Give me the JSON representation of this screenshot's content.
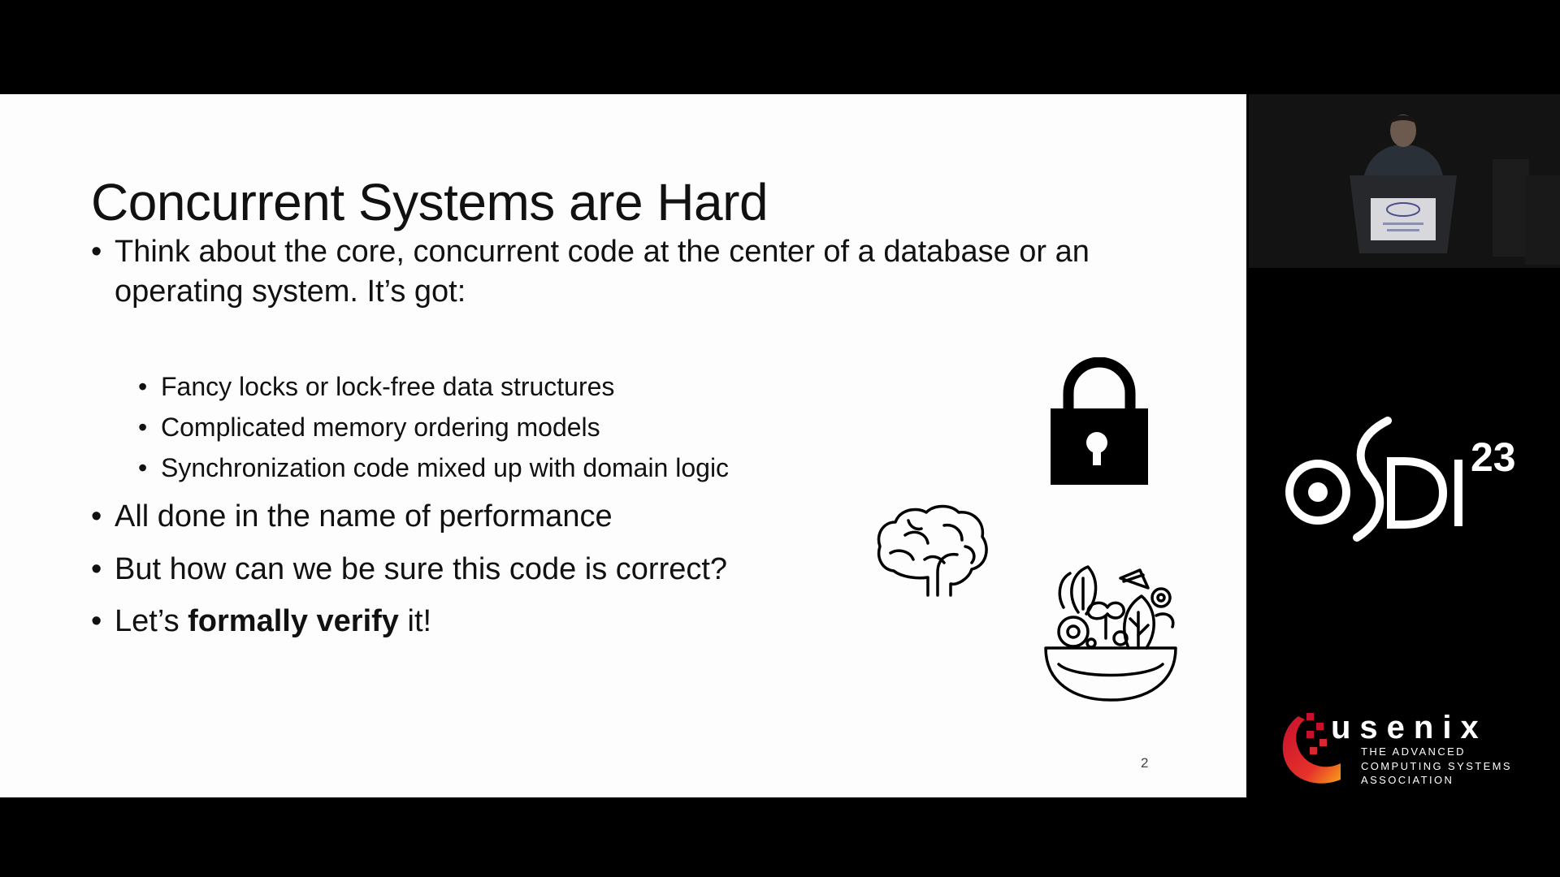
{
  "slide": {
    "title": "Concurrent Systems are Hard",
    "bullet_char": "•",
    "bullets": [
      "Think about the core, concurrent code at the center of a database or an operating system. It’s got:",
      "All done in the name of performance",
      "But how can we be sure this code is correct?"
    ],
    "sub_bullets": [
      "Fancy locks or lock-free data structures",
      "Complicated memory ordering models",
      "Synchronization code mixed up with domain logic"
    ],
    "last_bullet": {
      "prefix": "Let’s ",
      "bold": "formally verify",
      "suffix": " it!"
    },
    "page_number": "2",
    "icons": [
      "lock-icon",
      "brain-icon",
      "salad-bowl-icon"
    ]
  },
  "sidebar": {
    "osdi_logo_text": "OSDI",
    "osdi_year": "23",
    "usenix_wordmark": "usenix",
    "usenix_tagline": [
      "THE ADVANCED",
      "COMPUTING SYSTEMS",
      "ASSOCIATION"
    ]
  },
  "colors": {
    "slide_background": "#fdfdfd",
    "frame_background": "#000000",
    "usenix_red": "#d7282f"
  }
}
